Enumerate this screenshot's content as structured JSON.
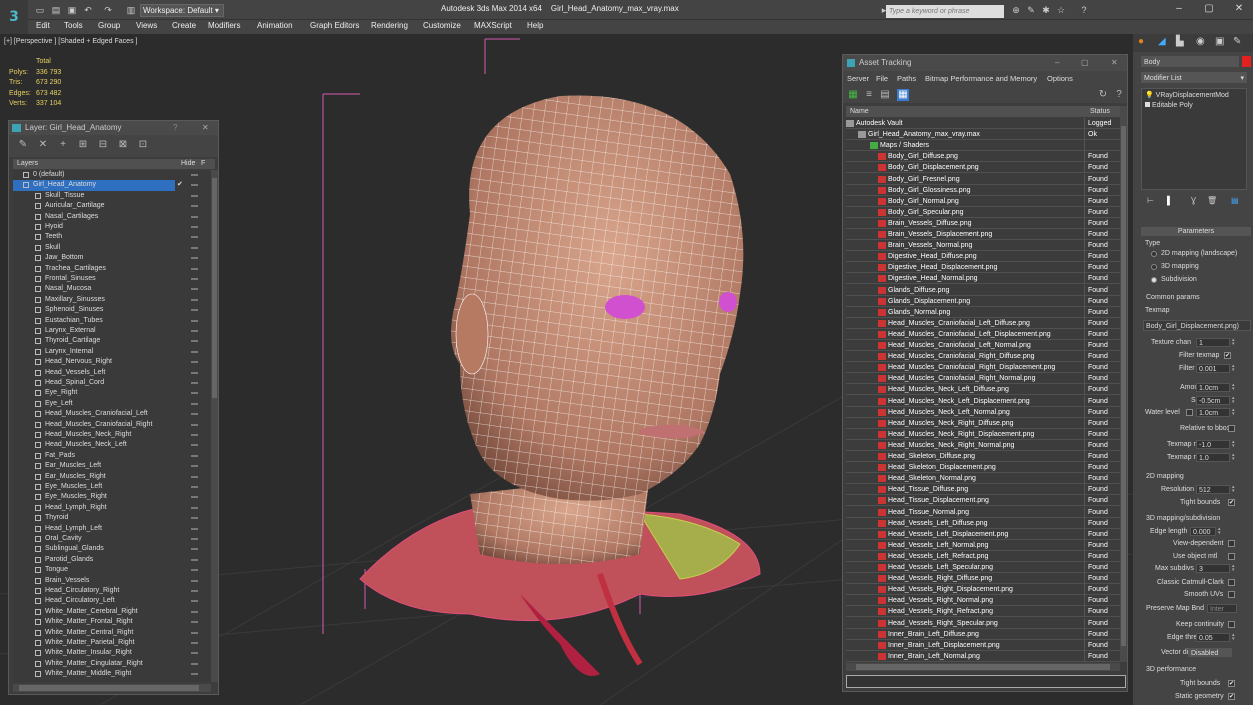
{
  "titlebar": {
    "title": "Autodesk 3ds Max 2014 x64    Girl_Head_Anatomy_max_vray.max",
    "workspace": "Workspace: Default",
    "search_placeholder": "Type a keyword or phrase"
  },
  "menu": [
    "Edit",
    "Tools",
    "Group",
    "Views",
    "Create",
    "Modifiers",
    "Animation",
    "Graph Editors",
    "Rendering",
    "Customize",
    "MAXScript",
    "Help"
  ],
  "viewport": {
    "label": "[+] [Perspective ] [Shaded + Edged Faces ]",
    "stats": {
      "heading": "Total",
      "rows": [
        {
          "k": "Polys:",
          "v": "336 793"
        },
        {
          "k": "Tris:",
          "v": "673 290"
        },
        {
          "k": "Edges:",
          "v": "673 482"
        },
        {
          "k": "Verts:",
          "v": "337 104"
        }
      ]
    }
  },
  "layer_panel": {
    "title": "Layer: Girl_Head_Anatomy",
    "col_layers": "Layers",
    "col_hide": "Hide",
    "col_f": "F",
    "items": [
      "0 (default)",
      "Girl_Head_Anatomy",
      "Skull_Tissue",
      "Auricular_Cartilage",
      "Nasal_Cartilages",
      "Hyoid",
      "Teeth",
      "Skull",
      "Jaw_Bottom",
      "Trachea_Cartilages",
      "Frontal_Sinuses",
      "Nasal_Mucosa",
      "Maxillary_Sinusses",
      "Sphenoid_Sinuses",
      "Eustachian_Tubes",
      "Larynx_External",
      "Thyroid_Cartilage",
      "Larynx_Internal",
      "Head_Nervous_Right",
      "Head_Vessels_Left",
      "Head_Spinal_Cord",
      "Eye_Right",
      "Eye_Left",
      "Head_Muscles_Craniofacial_Left",
      "Head_Muscles_Craniofacial_Right",
      "Head_Muscles_Neck_Right",
      "Head_Muscles_Neck_Left",
      "Fat_Pads",
      "Ear_Muscles_Left",
      "Ear_Muscles_Right",
      "Eye_Muscles_Left",
      "Eye_Muscles_Right",
      "Head_Lymph_Right",
      "Thyroid",
      "Head_Lymph_Left",
      "Oral_Cavity",
      "Sublingual_Glands",
      "Parotid_Glands",
      "Tongue",
      "Brain_Vessels",
      "Head_Circulatory_Right",
      "Head_Circulatory_Left",
      "White_Matter_Cerebral_Right",
      "White_Matter_Frontal_Right",
      "White_Matter_Central_Right",
      "White_Matter_Parietal_Right",
      "White_Matter_Insular_Right",
      "White_Matter_Cingulatar_Right",
      "White_Matter_Middle_Right"
    ]
  },
  "asset_panel": {
    "title": "Asset Tracking",
    "menu": [
      "Server",
      "File",
      "Paths",
      "Bitmap Performance and Memory",
      "Options"
    ],
    "col_name": "Name",
    "col_status": "Status",
    "rows": [
      {
        "n": "Autodesk Vault",
        "s": "Logged",
        "lvl": 0
      },
      {
        "n": "Girl_Head_Anatomy_max_vray.max",
        "s": "Ok",
        "lvl": 1
      },
      {
        "n": "Maps / Shaders",
        "s": "",
        "lvl": 2
      },
      {
        "n": "Body_Girl_Diffuse.png",
        "s": "Found",
        "lvl": 3
      },
      {
        "n": "Body_Girl_Displacement.png",
        "s": "Found",
        "lvl": 3
      },
      {
        "n": "Body_Girl_Fresnel.png",
        "s": "Found",
        "lvl": 3
      },
      {
        "n": "Body_Girl_Glossiness.png",
        "s": "Found",
        "lvl": 3
      },
      {
        "n": "Body_Girl_Normal.png",
        "s": "Found",
        "lvl": 3
      },
      {
        "n": "Body_Girl_Specular.png",
        "s": "Found",
        "lvl": 3
      },
      {
        "n": "Brain_Vessels_Diffuse.png",
        "s": "Found",
        "lvl": 3
      },
      {
        "n": "Brain_Vessels_Displacement.png",
        "s": "Found",
        "lvl": 3
      },
      {
        "n": "Brain_Vessels_Normal.png",
        "s": "Found",
        "lvl": 3
      },
      {
        "n": "Digestive_Head_Diffuse.png",
        "s": "Found",
        "lvl": 3
      },
      {
        "n": "Digestive_Head_Displacement.png",
        "s": "Found",
        "lvl": 3
      },
      {
        "n": "Digestive_Head_Normal.png",
        "s": "Found",
        "lvl": 3
      },
      {
        "n": "Glands_Diffuse.png",
        "s": "Found",
        "lvl": 3
      },
      {
        "n": "Glands_Displacement.png",
        "s": "Found",
        "lvl": 3
      },
      {
        "n": "Glands_Normal.png",
        "s": "Found",
        "lvl": 3
      },
      {
        "n": "Head_Muscles_Craniofacial_Left_Diffuse.png",
        "s": "Found",
        "lvl": 3
      },
      {
        "n": "Head_Muscles_Craniofacial_Left_Displacement.png",
        "s": "Found",
        "lvl": 3
      },
      {
        "n": "Head_Muscles_Craniofacial_Left_Normal.png",
        "s": "Found",
        "lvl": 3
      },
      {
        "n": "Head_Muscles_Craniofacial_Right_Diffuse.png",
        "s": "Found",
        "lvl": 3
      },
      {
        "n": "Head_Muscles_Craniofacial_Right_Displacement.png",
        "s": "Found",
        "lvl": 3
      },
      {
        "n": "Head_Muscles_Craniofacial_Right_Normal.png",
        "s": "Found",
        "lvl": 3
      },
      {
        "n": "Head_Muscles_Neck_Left_Diffuse.png",
        "s": "Found",
        "lvl": 3
      },
      {
        "n": "Head_Muscles_Neck_Left_Displacement.png",
        "s": "Found",
        "lvl": 3
      },
      {
        "n": "Head_Muscles_Neck_Left_Normal.png",
        "s": "Found",
        "lvl": 3
      },
      {
        "n": "Head_Muscles_Neck_Right_Diffuse.png",
        "s": "Found",
        "lvl": 3
      },
      {
        "n": "Head_Muscles_Neck_Right_Displacement.png",
        "s": "Found",
        "lvl": 3
      },
      {
        "n": "Head_Muscles_Neck_Right_Normal.png",
        "s": "Found",
        "lvl": 3
      },
      {
        "n": "Head_Skeleton_Diffuse.png",
        "s": "Found",
        "lvl": 3
      },
      {
        "n": "Head_Skeleton_Displacement.png",
        "s": "Found",
        "lvl": 3
      },
      {
        "n": "Head_Skeleton_Normal.png",
        "s": "Found",
        "lvl": 3
      },
      {
        "n": "Head_Tissue_Diffuse.png",
        "s": "Found",
        "lvl": 3
      },
      {
        "n": "Head_Tissue_Displacement.png",
        "s": "Found",
        "lvl": 3
      },
      {
        "n": "Head_Tissue_Normal.png",
        "s": "Found",
        "lvl": 3
      },
      {
        "n": "Head_Vessels_Left_Diffuse.png",
        "s": "Found",
        "lvl": 3
      },
      {
        "n": "Head_Vessels_Left_Displacement.png",
        "s": "Found",
        "lvl": 3
      },
      {
        "n": "Head_Vessels_Left_Normal.png",
        "s": "Found",
        "lvl": 3
      },
      {
        "n": "Head_Vessels_Left_Refract.png",
        "s": "Found",
        "lvl": 3
      },
      {
        "n": "Head_Vessels_Left_Specular.png",
        "s": "Found",
        "lvl": 3
      },
      {
        "n": "Head_Vessels_Right_Diffuse.png",
        "s": "Found",
        "lvl": 3
      },
      {
        "n": "Head_Vessels_Right_Displacement.png",
        "s": "Found",
        "lvl": 3
      },
      {
        "n": "Head_Vessels_Right_Normal.png",
        "s": "Found",
        "lvl": 3
      },
      {
        "n": "Head_Vessels_Right_Refract.png",
        "s": "Found",
        "lvl": 3
      },
      {
        "n": "Head_Vessels_Right_Specular.png",
        "s": "Found",
        "lvl": 3
      },
      {
        "n": "Inner_Brain_Left_Diffuse.png",
        "s": "Found",
        "lvl": 3
      },
      {
        "n": "Inner_Brain_Left_Displacement.png",
        "s": "Found",
        "lvl": 3
      },
      {
        "n": "Inner_Brain_Left_Normal.png",
        "s": "Found",
        "lvl": 3
      }
    ]
  },
  "command_panel": {
    "object_name": "Body",
    "modifier_list": "Modifier List",
    "stack": [
      "VRayDisplacementMod",
      "Editable Poly"
    ],
    "rollout_parameters": "Parameters",
    "type_label": "Type",
    "type_options": [
      "2D mapping (landscape)",
      "3D mapping",
      "Subdivision"
    ],
    "common_params": "Common params",
    "texmap_label": "Texmap",
    "texmap_value": "Body_Girl_Displacement.png)",
    "texture_chan_label": "Texture chan",
    "texture_chan": "1",
    "filter_texmap": "Filter texmap",
    "filter_blur_label": "Filter blur",
    "filter_blur": "0.001",
    "amount_label": "Amount",
    "amount": "1.0cm",
    "shift_label": "Shift",
    "shift": "-0.5cm",
    "water_level_label": "Water level",
    "water_level": "1.0cm",
    "relative_bbox": "Relative to bbox",
    "texmap_min_label": "Texmap min",
    "texmap_min": "-1.0",
    "texmap_max_label": "Texmap max",
    "texmap_max": "1.0",
    "mapping2d": "2D mapping",
    "resolution_label": "Resolution",
    "resolution": "512",
    "tight_bounds": "Tight bounds",
    "mapping3d": "3D mapping/subdivision",
    "edge_length_label": "Edge length",
    "edge_length": "0.000",
    "view_dependent": "View-dependent",
    "use_object_mtl": "Use object mtl",
    "max_subdivs_label": "Max subdivs",
    "max_subdivs": "3",
    "classic_catmull": "Classic Catmull-Clark",
    "smooth_uvs": "Smooth UVs",
    "preserve_map_bnd": "Preserve Map Bnd",
    "preserve_map_val": "Inter",
    "keep_continuity": "Keep continuity",
    "edge_thresh_label": "Edge thresh",
    "edge_thresh": "0.05",
    "vector_displ_label": "Vector displ",
    "vector_displ": "Disabled",
    "perf": "3D performance",
    "tight_bounds2": "Tight bounds",
    "static_geometry": "Static geometry"
  }
}
